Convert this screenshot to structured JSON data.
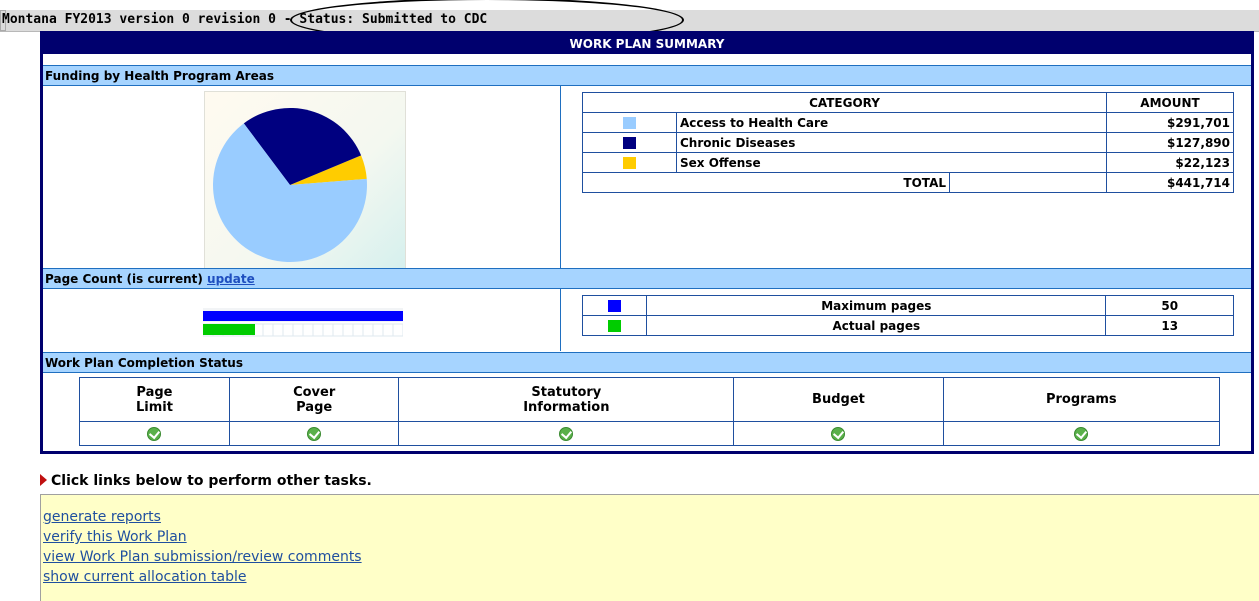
{
  "title": "Montana FY2013 version 0 revision 0 - Status: Submitted to CDC",
  "panel_title": "WORK PLAN SUMMARY",
  "funding": {
    "section_label": "Funding by Health Program Areas",
    "header_category": "CATEGORY",
    "header_amount": "AMOUNT",
    "rows": [
      {
        "label": "Access to Health Care",
        "amount": "$291,701",
        "color": "#99ccff"
      },
      {
        "label": "Chronic Diseases",
        "amount": "$127,890",
        "color": "#000080"
      },
      {
        "label": "Sex Offense",
        "amount": "$22,123",
        "color": "#ffcc00"
      }
    ],
    "total_label": "TOTAL",
    "total_amount": "$441,714"
  },
  "chart_data": {
    "type": "pie",
    "categories": [
      "Access to Health Care",
      "Chronic Diseases",
      "Sex Offense"
    ],
    "values": [
      291701,
      127890,
      22123
    ],
    "colors": [
      "#99ccff",
      "#000080",
      "#ffcc00"
    ]
  },
  "page_count": {
    "section_label": "Page Count (is current)",
    "update_link": "update",
    "rows": [
      {
        "label": "Maximum pages",
        "value": "50",
        "color": "#0000ff"
      },
      {
        "label": "Actual pages",
        "value": "13",
        "color": "#00cc00"
      }
    ],
    "max_fill": 1.0,
    "actual_fill": 0.26
  },
  "completion": {
    "section_label": "Work Plan Completion Status",
    "columns": [
      {
        "line1": "Page",
        "line2": "Limit",
        "status": "complete"
      },
      {
        "line1": "Cover",
        "line2": "Page",
        "status": "complete"
      },
      {
        "line1": "Statutory",
        "line2": "Information",
        "status": "complete"
      },
      {
        "line1": "Budget",
        "line2": "",
        "status": "complete"
      },
      {
        "line1": "Programs",
        "line2": "",
        "status": "complete"
      }
    ]
  },
  "tasks": {
    "heading": "Click links below to perform other tasks.",
    "links": [
      "generate reports",
      "verify this Work Plan",
      "view Work Plan submission/review comments",
      "show current allocation table"
    ]
  }
}
